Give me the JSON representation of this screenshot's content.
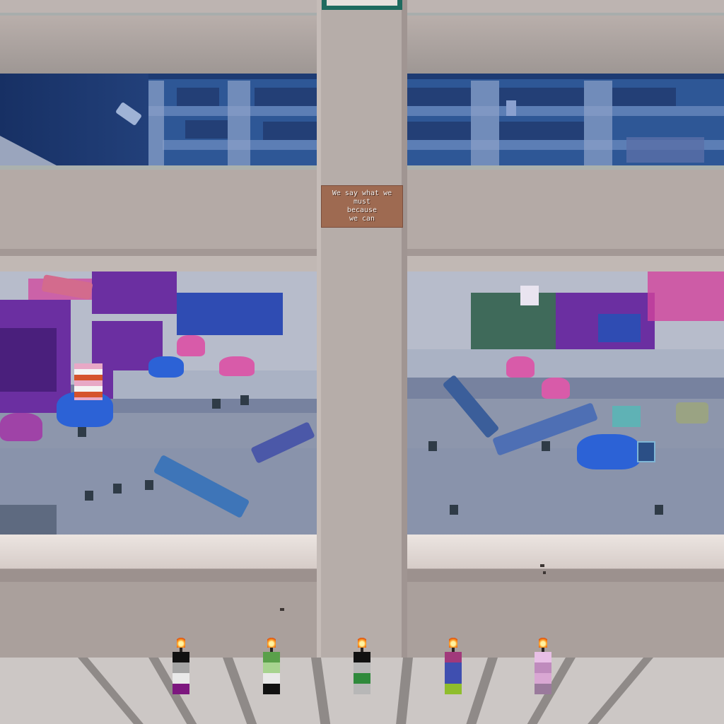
{
  "sign": {
    "lines": [
      "We say what we",
      "must",
      "because",
      "we can"
    ]
  },
  "candles": [
    {
      "name": "asexual-candle",
      "colors": [
        "#111111",
        "#a4a4a4",
        "#e9e9e9",
        "#7d177f"
      ]
    },
    {
      "name": "aromantic-candle",
      "colors": [
        "#5aa04a",
        "#a7d38f",
        "#e9e9e9",
        "#111111"
      ]
    },
    {
      "name": "agender-candle",
      "colors": [
        "#111111",
        "#b7b7b7",
        "#2f8a3c",
        "#b7b7b7"
      ]
    },
    {
      "name": "bisexual-lake-candle",
      "colors": [
        "#a1397b",
        "#3f4fb0",
        "#3f4fb0",
        "#8fbd2c"
      ]
    },
    {
      "name": "lesbian-pink-candle",
      "colors": [
        "#e8bfe6",
        "#bf8bbd",
        "#d9a7d3",
        "#9a7a9c"
      ]
    }
  ],
  "palette": {
    "wall": "#b0a5a2",
    "water": "#1d3b73",
    "sign_wood": "#9e6a51",
    "hatch": "#1f6b5f"
  },
  "icons": [
    "flame-icon",
    "smoke-particle-icon"
  ]
}
